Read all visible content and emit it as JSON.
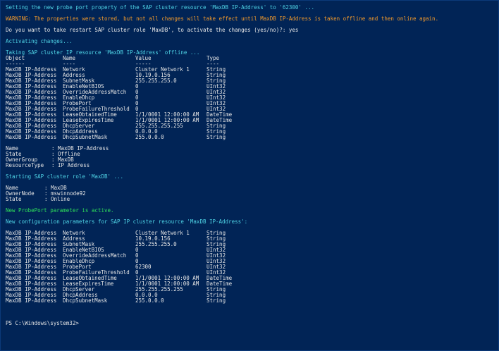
{
  "messages": {
    "setting": "Setting the new probe port property of the SAP cluster resource 'MaxDB IP-Address' to '62300' ...",
    "warning": "WARNING: The properties were stored, but not all changes will take effect until MaxDB IP-Address is taken offline and then online again.",
    "prompt": "Do you want to take restart SAP cluster role 'MaxDB', to activate the changes (yes/no)?: yes",
    "activating": "Activating changes...",
    "taking_offline": "Taking SAP cluster IP resource 'MaxDB IP-Address' offline ...",
    "starting_role": "Starting SAP cluster role 'MaxDB' ...",
    "probeport_active": "New ProbePort parameter is active.",
    "new_config": "New configuration parameters for SAP IP cluster resource 'MaxDB IP-Address':",
    "ps_prompt": "PS C:\\Windows\\system32>"
  },
  "table1": {
    "headers": [
      "Object",
      "Name",
      "Value",
      "Type"
    ],
    "underlines": [
      "------",
      "----",
      "-----",
      "----"
    ],
    "rows": [
      [
        "MaxDB IP-Address",
        "Network",
        "Cluster Network 1",
        "String"
      ],
      [
        "MaxDB IP-Address",
        "Address",
        "10.19.0.156",
        "String"
      ],
      [
        "MaxDB IP-Address",
        "SubnetMask",
        "255.255.255.0",
        "String"
      ],
      [
        "MaxDB IP-Address",
        "EnableNetBIOS",
        "0",
        "UInt32"
      ],
      [
        "MaxDB IP-Address",
        "OverrideAddressMatch",
        "0",
        "UInt32"
      ],
      [
        "MaxDB IP-Address",
        "EnableDhcp",
        "0",
        "UInt32"
      ],
      [
        "MaxDB IP-Address",
        "ProbePort",
        "0",
        "UInt32"
      ],
      [
        "MaxDB IP-Address",
        "ProbeFailureThreshold",
        "0",
        "UInt32"
      ],
      [
        "MaxDB IP-Address",
        "LeaseObtainedTime",
        "1/1/0001 12:00:00 AM",
        "DateTime"
      ],
      [
        "MaxDB IP-Address",
        "LeaseExpiresTime",
        "1/1/0001 12:00:00 AM",
        "DateTime"
      ],
      [
        "MaxDB IP-Address",
        "DhcpServer",
        "255.255.255.255",
        "String"
      ],
      [
        "MaxDB IP-Address",
        "DhcpAddress",
        "0.0.0.0",
        "String"
      ],
      [
        "MaxDB IP-Address",
        "DhcpSubnetMask",
        "255.0.0.0",
        "String"
      ]
    ]
  },
  "resource_status": [
    [
      "Name",
      ": MaxDB IP-Address"
    ],
    [
      "State",
      ": Offline"
    ],
    [
      "OwnerGroup",
      ": MaxDB"
    ],
    [
      "ResourceType",
      ": IP Address"
    ]
  ],
  "role_status": [
    [
      "Name",
      ": MaxDB"
    ],
    [
      "OwnerNode",
      ": mswinnode92"
    ],
    [
      "State",
      ": Online"
    ]
  ],
  "table2": {
    "rows": [
      [
        "MaxDB IP-Address",
        "Network",
        "Cluster Network 1",
        "String"
      ],
      [
        "MaxDB IP-Address",
        "Address",
        "10.19.0.156",
        "String"
      ],
      [
        "MaxDB IP-Address",
        "SubnetMask",
        "255.255.255.0",
        "String"
      ],
      [
        "MaxDB IP-Address",
        "EnableNetBIOS",
        "0",
        "UInt32"
      ],
      [
        "MaxDB IP-Address",
        "OverrideAddressMatch",
        "0",
        "UInt32"
      ],
      [
        "MaxDB IP-Address",
        "EnableDhcp",
        "0",
        "UInt32"
      ],
      [
        "MaxDB IP-Address",
        "ProbePort",
        "62300",
        "UInt32"
      ],
      [
        "MaxDB IP-Address",
        "ProbeFailureThreshold",
        "0",
        "UInt32"
      ],
      [
        "MaxDB IP-Address",
        "LeaseObtainedTime",
        "1/1/0001 12:00:00 AM",
        "DateTime"
      ],
      [
        "MaxDB IP-Address",
        "LeaseExpiresTime",
        "1/1/0001 12:00:00 AM",
        "DateTime"
      ],
      [
        "MaxDB IP-Address",
        "DhcpServer",
        "255.255.255.255",
        "String"
      ],
      [
        "MaxDB IP-Address",
        "DhcpAddress",
        "0.0.0.0",
        "String"
      ],
      [
        "MaxDB IP-Address",
        "DhcpSubnetMask",
        "255.0.0.0",
        "String"
      ]
    ]
  },
  "colors": {
    "background": "#012456",
    "text": "#e6e6e6",
    "info": "#4fd4e6",
    "warning": "#f39a2b",
    "success": "#2ee05a"
  }
}
